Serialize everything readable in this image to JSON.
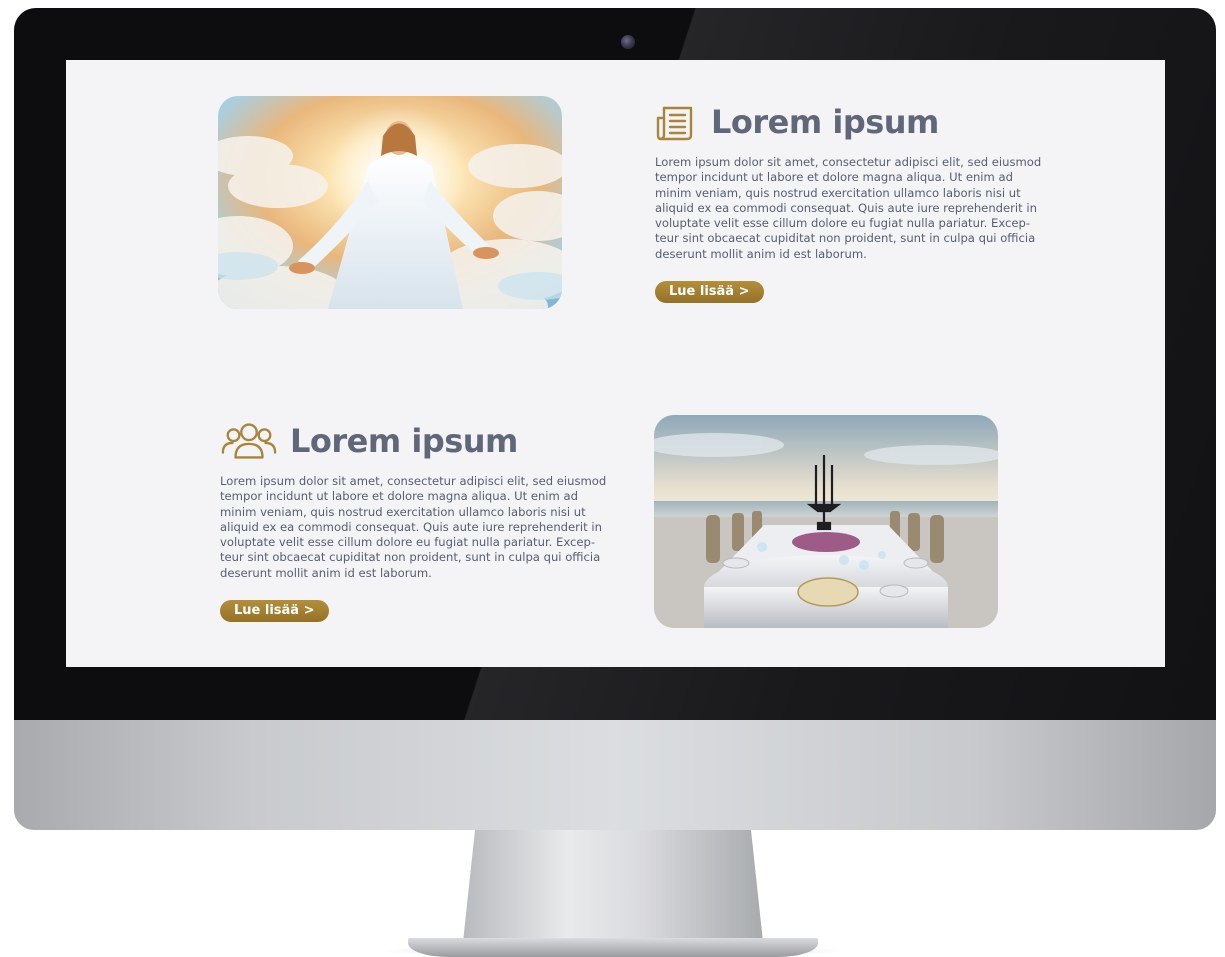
{
  "section_1": {
    "icon": "document-icon",
    "title": "Lorem ipsum",
    "body": "Lorem ipsum dolor sit amet, consectetur adipisci elit, sed eiusmod\ntempor incidunt ut labore et dolore magna aliqua. Ut enim ad\nminim veniam, quis nostrud exercitation ullamco laboris nisi ut\naliquid ex ea commodi consequat. Quis aute iure reprehenderit in\nvoluptate velit esse cillum dolore eu fugiat nulla pariatur. Excep-\nteur sint obcaecat cupiditat non proident, sunt in culpa qui officia\ndeserunt mollit anim id est laborum.",
    "button_label": "Lue lisää >"
  },
  "section_2": {
    "icon": "group-icon",
    "title": "Lorem ipsum",
    "body": "Lorem ipsum dolor sit amet, consectetur adipisci elit, sed eiusmod\ntempor incidunt ut labore et dolore magna aliqua. Ut enim ad\nminim veniam, quis nostrud exercitation ullamco laboris nisi ut\naliquid ex ea commodi consequat. Quis aute iure reprehenderit in\nvoluptate velit esse cillum dolore eu fugiat nulla pariatur. Excep-\nteur sint obcaecat cupiditat non proident, sunt in culpa qui officia\ndeserunt mollit anim id est laborum.",
    "button_label": "Lue lisää >"
  },
  "colors": {
    "accent_gold": "#a8853a",
    "heading": "#5f6778",
    "body_text": "#565e6f",
    "screen_background": "#f4f4f6"
  }
}
